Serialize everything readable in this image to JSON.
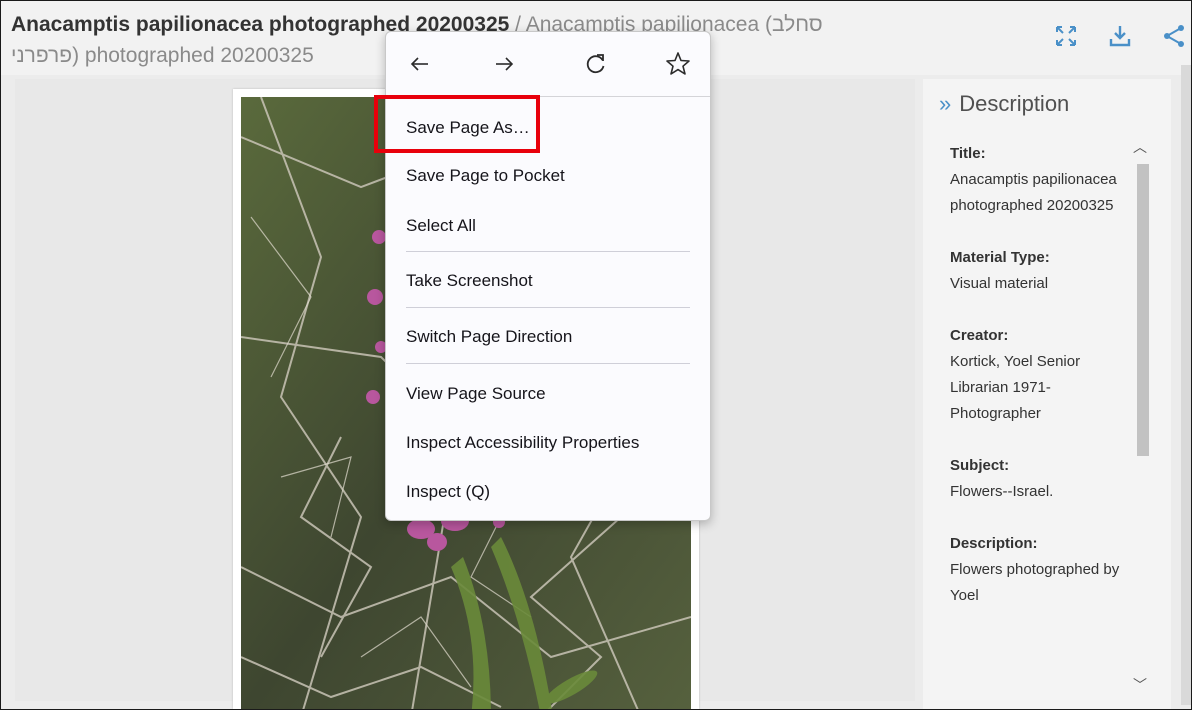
{
  "header": {
    "title_bold": "Anacamptis papilionacea photographed 20200325",
    "title_rest": " / Anacamptis papilionacea (סחלב",
    "title_line2_rtl": "פרפרני",
    "title_line2": ") photographed 20200325",
    "icons": [
      "expand-icon",
      "download-icon",
      "share-icon"
    ]
  },
  "context_menu": {
    "nav_icons": [
      "back-arrow-icon",
      "forward-arrow-icon",
      "reload-icon",
      "bookmark-star-icon"
    ],
    "items": [
      {
        "label": "Save Page As…"
      },
      {
        "label": "Save Page to Pocket"
      },
      {
        "label": "Select All"
      },
      {
        "label": "Take Screenshot"
      },
      {
        "label": "Switch Page Direction"
      },
      {
        "label": "View Page Source"
      },
      {
        "label": "Inspect Accessibility Properties"
      },
      {
        "label": "Inspect (Q)"
      }
    ]
  },
  "description": {
    "heading": "Description",
    "fields": [
      {
        "label": "Title:",
        "value": "Anacamptis papilionacea photographed 20200325"
      },
      {
        "label": "Material Type:",
        "value": "Visual material"
      },
      {
        "label": "Creator:",
        "value": "Kortick, Yoel Senior Librarian 1971- Photographer"
      },
      {
        "label": "Subject:",
        "value": "Flowers--Israel."
      },
      {
        "label": "Description:",
        "value": "Flowers photographed by Yoel"
      }
    ]
  },
  "colors": {
    "accent": "#4a90c8",
    "highlight": "#e8000b"
  }
}
